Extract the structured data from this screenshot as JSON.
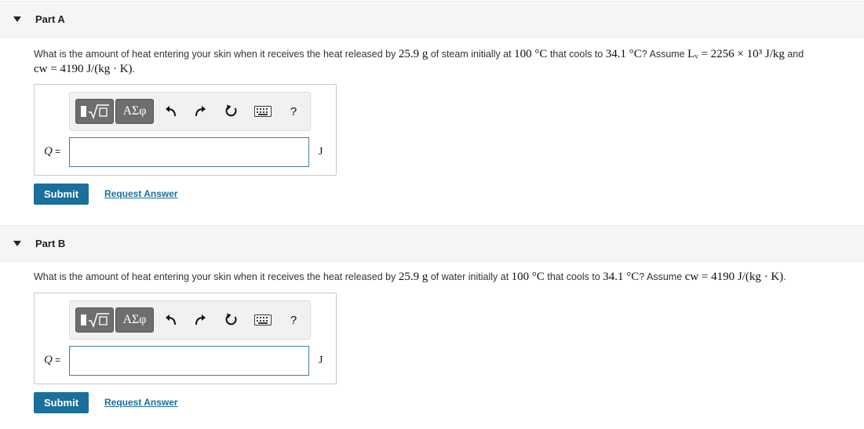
{
  "parts": [
    {
      "title": "Part A",
      "question": {
        "t1": "What is the amount of heat entering your skin when it receives the heat released by ",
        "mass": "25.9 g",
        "t2": " of steam initially at ",
        "temp_init": "100 °C",
        "t3": " that cools to ",
        "temp_final": "34.1 °C",
        "t4": "? Assume ",
        "const1": "Lᵥ = 2256 × 10³ J/kg",
        "t5": " and",
        "const2": "cw = 4190 J/(kg · K)",
        "t6": "."
      },
      "variable": "Q",
      "equals": " =",
      "input_value": "",
      "unit": "J",
      "submit_label": "Submit",
      "request_label": "Request Answer"
    },
    {
      "title": "Part B",
      "question": {
        "t1": "What is the amount of heat entering your skin when it receives the heat released by ",
        "mass": "25.9 g",
        "t2": " of water initially at ",
        "temp_init": "100 °C",
        "t3": " that cools to ",
        "temp_final": "34.1 °C",
        "t4": "? Assume ",
        "const2": "cw = 4190 J/(kg · K)",
        "t6": "."
      },
      "variable": "Q",
      "equals": " =",
      "input_value": "",
      "unit": "J",
      "submit_label": "Submit",
      "request_label": "Request Answer"
    }
  ],
  "toolbar": {
    "templates_icon": "templates-icon",
    "greek_label": "ΑΣφ",
    "undo_icon": "undo-icon",
    "redo_icon": "redo-icon",
    "reset_icon": "reset-icon",
    "keyboard_icon": "keyboard-icon",
    "help_label": "?"
  },
  "colors": {
    "submit_bg": "#1a6f9c",
    "link": "#1a6f9c",
    "header_bg": "#f5f5f5",
    "toolbar_button": "#6e6e6e"
  }
}
